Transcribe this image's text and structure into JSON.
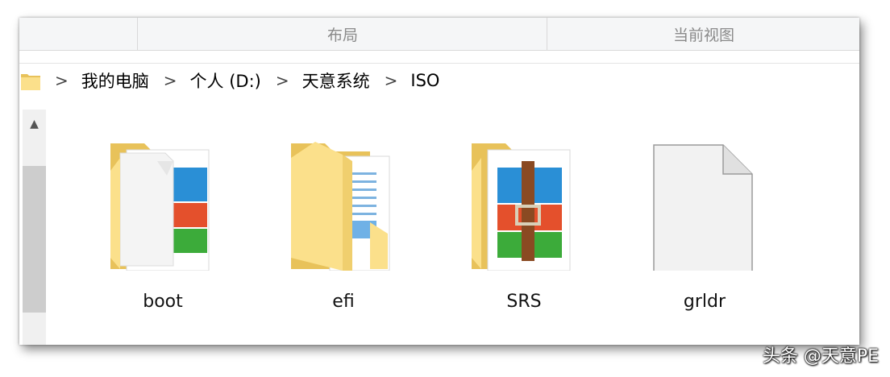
{
  "ribbon": {
    "groups": [
      {
        "label": ""
      },
      {
        "label": "布局"
      },
      {
        "label": "当前视图"
      }
    ]
  },
  "address": {
    "separator": ">",
    "breadcrumbs": [
      "我的电脑",
      "个人 (D:)",
      "天意系统",
      "ISO"
    ]
  },
  "scrollbar": {
    "up_glyph": "▲"
  },
  "files": [
    {
      "name": "boot",
      "type": "folder-archive"
    },
    {
      "name": "efi",
      "type": "folder-document"
    },
    {
      "name": "SRS",
      "type": "folder-archive-open"
    },
    {
      "name": "grldr",
      "type": "blank-file"
    }
  ],
  "watermark": "头条 @天意PE",
  "colors": {
    "folder_back": "#e8c25a",
    "folder_front": "#fbe08b",
    "archive_blue": "#2a8fd6",
    "archive_red": "#e4502c",
    "archive_green": "#3cab3a",
    "strap": "#8a4a22"
  }
}
